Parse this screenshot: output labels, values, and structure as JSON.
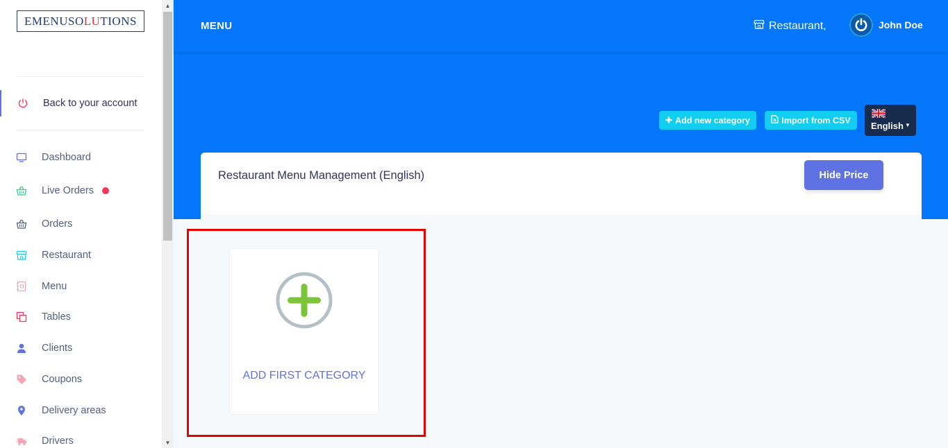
{
  "sidebar": {
    "logo_parts": [
      "EMENUSO",
      "LU",
      "TIONS"
    ],
    "back_label": "Back to your account",
    "items": [
      {
        "label": "Dashboard",
        "icon": "monitor-icon",
        "color": "#5e72e4"
      },
      {
        "label": "Live Orders",
        "icon": "basket-icon",
        "color": "#2dce89"
      },
      {
        "label": "Orders",
        "icon": "basket-icon",
        "color": "#525f7f"
      },
      {
        "label": "Restaurant",
        "icon": "shop-icon",
        "color": "#11cdef"
      },
      {
        "label": "Menu",
        "icon": "menu-icon",
        "color": "#f3a4b5"
      },
      {
        "label": "Tables",
        "icon": "tables-icon",
        "color": "#f5365c"
      },
      {
        "label": "Clients",
        "icon": "user-icon",
        "color": "#5e72e4"
      },
      {
        "label": "Coupons",
        "icon": "tag-icon",
        "color": "#f3a4b5"
      },
      {
        "label": "Delivery areas",
        "icon": "map-pin-icon",
        "color": "#5e72e4"
      },
      {
        "label": "Drivers",
        "icon": "delivery-icon",
        "color": "#f3a4b5"
      }
    ]
  },
  "header": {
    "title": "MENU",
    "restaurant_link": "Restaurant,",
    "user_name": "John Doe"
  },
  "toolbar": {
    "add_category": "Add new category",
    "import_csv": "Import from CSV",
    "language": "English"
  },
  "card": {
    "title": "Restaurant Menu Management (English)",
    "hide_price": "Hide Price",
    "add_first_category": "ADD FIRST CATEGORY"
  },
  "colors": {
    "primary": "#0376f9",
    "accent": "#5e72e4",
    "cyan": "#11cdef",
    "highlight": "#e80000",
    "plus_green": "#7cc53b"
  }
}
